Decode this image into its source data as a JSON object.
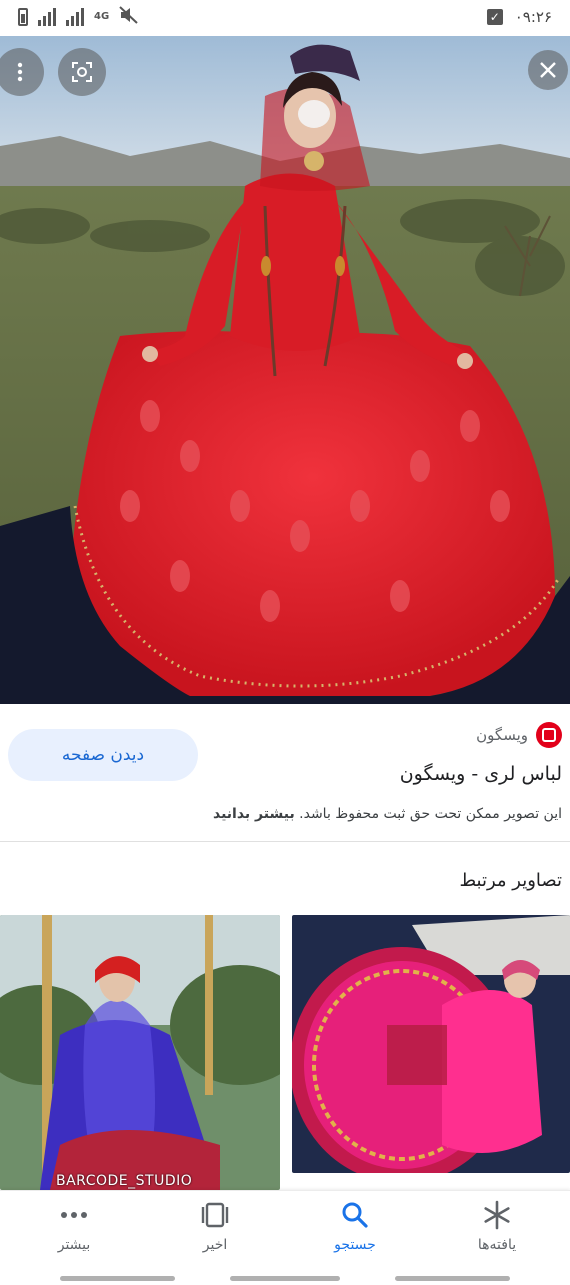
{
  "status_bar": {
    "network": "4G",
    "time": "۰۹:۲۶"
  },
  "image_result": {
    "source_name": "ویسگون",
    "title": "لباس لری - ویسگون",
    "view_page_label": "دیدن صفحه",
    "copyright_notice": "این تصویر ممکن تحت حق ثبت محفوظ باشد.",
    "learn_more_label": "بیشتر بدانید",
    "source_logo_color": "#e2001a"
  },
  "related": {
    "heading": "تصاویر مرتبط",
    "left_watermark": "BARCODE_STUDIO"
  },
  "bottom_nav": {
    "items": [
      {
        "label": "بیشتر",
        "icon": "more-dots-icon",
        "active": false
      },
      {
        "label": "اخیر",
        "icon": "recent-tabs-icon",
        "active": false
      },
      {
        "label": "جستجو",
        "icon": "search-icon",
        "active": true
      },
      {
        "label": "یافته‌ها",
        "icon": "discover-asterisk-icon",
        "active": false
      }
    ],
    "active_color": "#1a73e8"
  }
}
